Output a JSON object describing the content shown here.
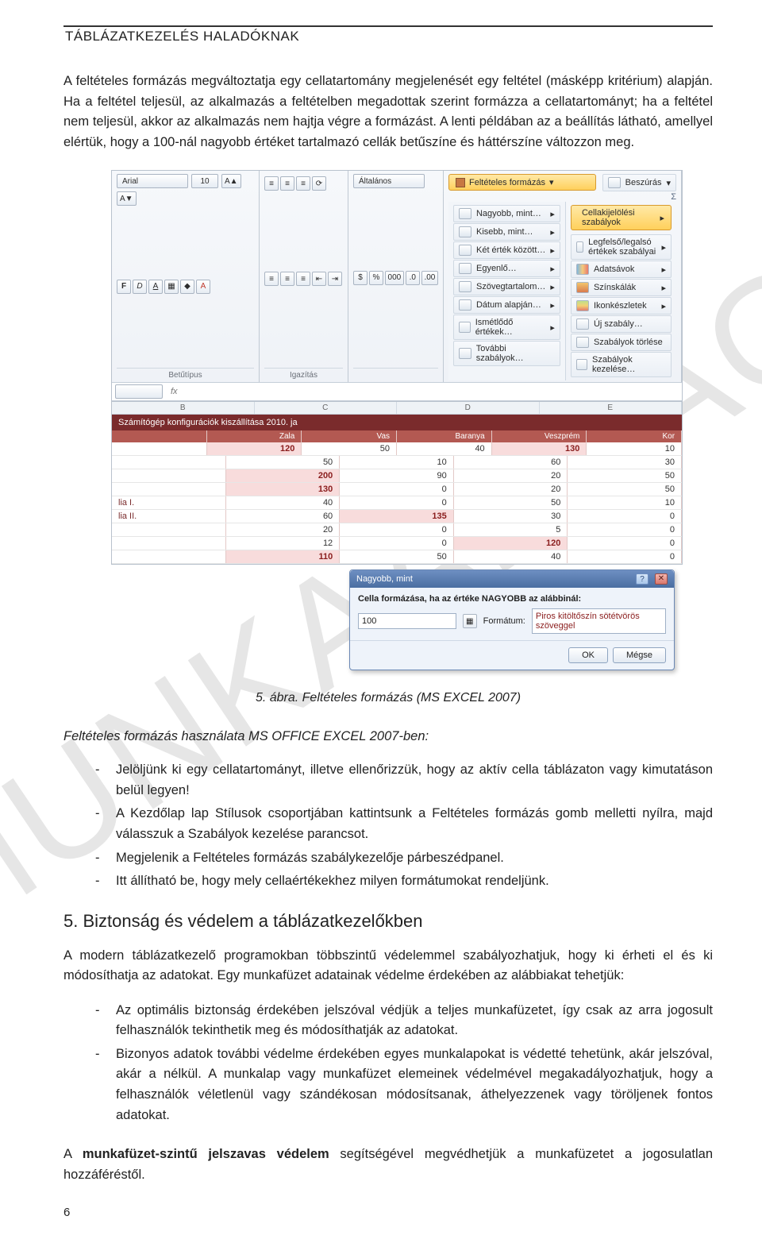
{
  "header": {
    "title": "TÁBLÁZATKEZELÉS HALADÓKNAK"
  },
  "watermark": "MUNKAANYAG",
  "paragraphs": {
    "p1": "A feltételes formázás megváltoztatja egy cellatartomány megjelenését egy feltétel (másképp kritérium) alapján. Ha a feltétel teljesül, az alkalmazás a feltételben megadottak szerint formázza a cellatartományt; ha a feltétel nem teljesül, akkor az alkalmazás nem hajtja végre a formázást. A lenti példában az a beállítás látható, amellyel elértük, hogy a 100-nál nagyobb értéket tartalmazó cellák betűszíne és háttérszíne változzon meg.",
    "caption": "5. ábra. Feltételes formázás (MS EXCEL 2007)",
    "subhead": "Feltételes formázás használata MS OFFICE EXCEL 2007-ben:",
    "li1": "Jelöljünk ki egy cellatartományt, illetve ellenőrizzük, hogy az aktív cella táblázaton vagy kimutatáson belül legyen!",
    "li2": "A Kezdőlap lap Stílusok csoportjában kattintsunk a Feltételes formázás gomb melletti nyílra, majd válasszuk a Szabályok kezelése parancsot.",
    "li3": "Megjelenik a Feltételes formázás szabálykezelője párbeszédpanel.",
    "li4": "Itt állítható be, hogy mely cellaértékekhez milyen formátumokat rendeljünk.",
    "h2": "5. Biztonság és védelem a táblázatkezelőkben",
    "p2": "A modern táblázatkezelő programokban többszintű védelemmel szabályozhatjuk, hogy ki érheti el és ki módosíthatja az adatokat. Egy munkafüzet adatainak védelme érdekében az alábbiakat tehetjük:",
    "li5": "Az optimális biztonság érdekében jelszóval védjük a teljes munkafüzetet, így csak az arra jogosult felhasználók tekinthetik meg és módosíthatják az adatokat.",
    "li6": "Bizonyos adatok további védelme érdekében egyes munkalapokat is védetté tehetünk, akár jelszóval, akár a nélkül. A munkalap vagy munkafüzet elemeinek védelmével megakadályozhatjuk, hogy a felhasználók véletlenül vagy szándékosan módosítsanak, áthelyezzenek vagy töröljenek fontos adatokat.",
    "p3a": "A ",
    "p3b": "munkafüzet-szintű jelszavas védelem",
    "p3c": " segítségével megvédhetjük a munkafüzetet a jogosulatlan hozzáféréstől.",
    "pagenum": "6"
  },
  "figure": {
    "font_name": "Arial",
    "font_size": "10",
    "panel_font": "Betűtípus",
    "panel_align": "Igazítás",
    "panel_num": "Általános",
    "btn_cond_fmt": "Feltételes formázás",
    "btn_insert": "Beszúrás",
    "menu_col1": [
      "Nagyobb, mint…",
      "Kisebb, mint…",
      "Két érték között…",
      "Egyenlő…",
      "Szövegtartalom…",
      "Dátum alapján…",
      "Ismétlődő értékek…",
      "További szabályok…"
    ],
    "menu_col2_hl": "Cellakijelölési szabályok",
    "menu_col2": [
      "Legfelső/legalsó értékek szabályai",
      "Adatsávok",
      "Színskálák",
      "Ikonkészletek",
      "Új szabály…",
      "Szabályok törlése",
      "Szabályok kezelése…"
    ],
    "cols": [
      "B",
      "C",
      "D",
      "E"
    ],
    "sheet_title": "Számítógép konfigurációk kiszállítása 2010. ja",
    "col_headers": [
      "Zala",
      "Vas",
      "Baranya",
      "Veszprém",
      "Kor"
    ],
    "rows": [
      {
        "label": "",
        "c": [
          "120",
          "50",
          "40",
          "130"
        ],
        "over": [
          true,
          false,
          false,
          true
        ],
        "e": "10"
      },
      {
        "label": "",
        "c": [
          "50",
          "10",
          "60"
        ],
        "over": [
          false,
          false,
          false
        ],
        "e": "30"
      },
      {
        "label": "",
        "c": [
          "200",
          "90",
          "20"
        ],
        "over": [
          true,
          false,
          false
        ],
        "e": "50"
      },
      {
        "label": "",
        "c": [
          "130",
          "0",
          "20"
        ],
        "over": [
          true,
          false,
          false
        ],
        "e": "50"
      },
      {
        "label": "lia I.",
        "c": [
          "40",
          "0",
          "50"
        ],
        "over": [
          false,
          false,
          false
        ],
        "e": "10"
      },
      {
        "label": "lia II.",
        "c": [
          "60",
          "135",
          "30"
        ],
        "over": [
          false,
          true,
          false
        ],
        "e": "0"
      },
      {
        "label": "",
        "c": [
          "20",
          "0",
          "5"
        ],
        "over": [
          false,
          false,
          false
        ],
        "e": "0"
      },
      {
        "label": "",
        "c": [
          "12",
          "0",
          "120"
        ],
        "over": [
          false,
          false,
          true
        ],
        "e": "0"
      },
      {
        "label": "",
        "c": [
          "110",
          "50",
          "40"
        ],
        "over": [
          true,
          false,
          false
        ],
        "e": "0"
      }
    ],
    "col_e_extra": "10",
    "dialog": {
      "title": "Nagyobb, mint",
      "prompt": "Cella formázása, ha az értéke NAGYOBB az alábbinál:",
      "value": "100",
      "fmt_label": "Formátum:",
      "fmt_value": "Piros kitöltőszín sötétvörös szöveggel",
      "ok": "OK",
      "cancel": "Mégse"
    },
    "chart_data": {
      "type": "table",
      "title": "Számítógép konfigurációk kiszállítása 2010.",
      "columns": [
        "Zala",
        "Vas",
        "Baranya",
        "Veszprém"
      ],
      "rows": [
        [
          120,
          50,
          40,
          130
        ],
        [
          50,
          10,
          60,
          30
        ],
        [
          200,
          90,
          20,
          50
        ],
        [
          130,
          0,
          20,
          50
        ],
        [
          40,
          0,
          50,
          10
        ],
        [
          60,
          135,
          30,
          0
        ],
        [
          20,
          0,
          5,
          0
        ],
        [
          12,
          0,
          120,
          0
        ],
        [
          110,
          50,
          40,
          0
        ]
      ],
      "highlight_rule": ">100"
    }
  }
}
